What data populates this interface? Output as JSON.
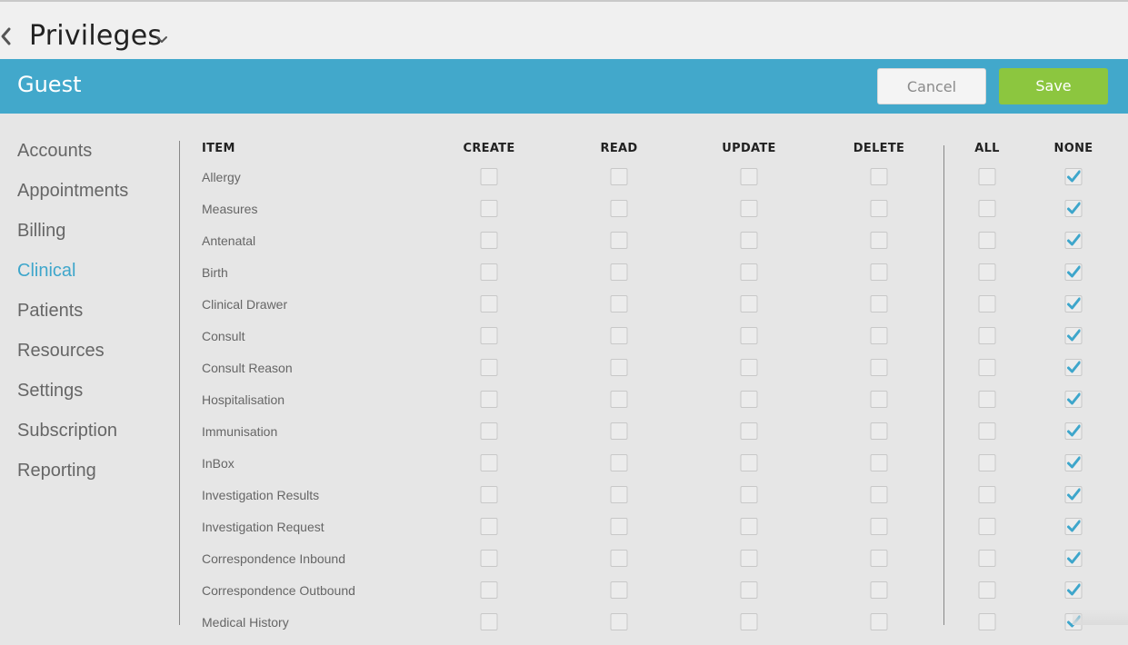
{
  "page": {
    "title": "Privileges",
    "back_icon": "chevron-left-icon",
    "dropdown_icon": "chevron-down-icon"
  },
  "header": {
    "role_name": "Guest",
    "cancel_label": "Cancel",
    "save_label": "Save",
    "band_color": "#42a8cb",
    "save_color": "#8cc63f"
  },
  "sidebar": {
    "items": [
      {
        "label": "Accounts",
        "active": false
      },
      {
        "label": "Appointments",
        "active": false
      },
      {
        "label": "Billing",
        "active": false
      },
      {
        "label": "Clinical",
        "active": true
      },
      {
        "label": "Patients",
        "active": false
      },
      {
        "label": "Resources",
        "active": false
      },
      {
        "label": "Settings",
        "active": false
      },
      {
        "label": "Subscription",
        "active": false
      },
      {
        "label": "Reporting",
        "active": false
      }
    ],
    "active_color": "#3ea6cb"
  },
  "table": {
    "columns": [
      "ITEM",
      "CREATE",
      "READ",
      "UPDATE",
      "DELETE",
      "ALL",
      "NONE"
    ],
    "check_color": "#3ea6cb",
    "rows": [
      {
        "label": "Allergy",
        "create": false,
        "read": false,
        "update": false,
        "delete": false,
        "all": false,
        "none": true
      },
      {
        "label": "Measures",
        "create": false,
        "read": false,
        "update": false,
        "delete": false,
        "all": false,
        "none": true
      },
      {
        "label": "Antenatal",
        "create": false,
        "read": false,
        "update": false,
        "delete": false,
        "all": false,
        "none": true
      },
      {
        "label": "Birth",
        "create": false,
        "read": false,
        "update": false,
        "delete": false,
        "all": false,
        "none": true
      },
      {
        "label": "Clinical Drawer",
        "create": false,
        "read": false,
        "update": false,
        "delete": false,
        "all": false,
        "none": true
      },
      {
        "label": "Consult",
        "create": false,
        "read": false,
        "update": false,
        "delete": false,
        "all": false,
        "none": true
      },
      {
        "label": "Consult Reason",
        "create": false,
        "read": false,
        "update": false,
        "delete": false,
        "all": false,
        "none": true
      },
      {
        "label": "Hospitalisation",
        "create": false,
        "read": false,
        "update": false,
        "delete": false,
        "all": false,
        "none": true
      },
      {
        "label": "Immunisation",
        "create": false,
        "read": false,
        "update": false,
        "delete": false,
        "all": false,
        "none": true
      },
      {
        "label": "InBox",
        "create": false,
        "read": false,
        "update": false,
        "delete": false,
        "all": false,
        "none": true
      },
      {
        "label": "Investigation Results",
        "create": false,
        "read": false,
        "update": false,
        "delete": false,
        "all": false,
        "none": true
      },
      {
        "label": "Investigation Request",
        "create": false,
        "read": false,
        "update": false,
        "delete": false,
        "all": false,
        "none": true
      },
      {
        "label": "Correspondence Inbound",
        "create": false,
        "read": false,
        "update": false,
        "delete": false,
        "all": false,
        "none": true
      },
      {
        "label": "Correspondence Outbound",
        "create": false,
        "read": false,
        "update": false,
        "delete": false,
        "all": false,
        "none": true
      },
      {
        "label": "Medical History",
        "create": false,
        "read": false,
        "update": false,
        "delete": false,
        "all": false,
        "none": true
      }
    ]
  }
}
